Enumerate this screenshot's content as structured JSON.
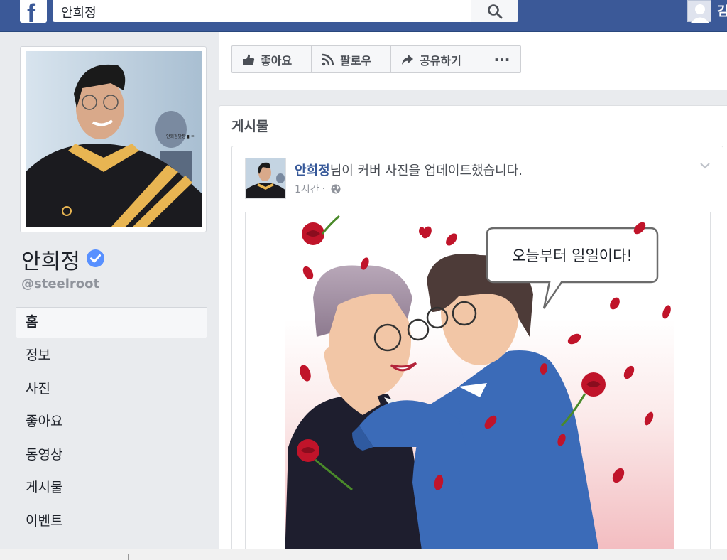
{
  "topbar": {
    "logo": "f",
    "search_value": "안희정",
    "search_icon": "search-icon",
    "user_name_partial": "김"
  },
  "profile": {
    "name": "안희정",
    "handle": "@steelroot",
    "verified_icon": "verified-badge-icon",
    "photo_caption": "안희정맞짱 ▮ ㄷ"
  },
  "nav": {
    "items": [
      {
        "label": "홈",
        "active": true
      },
      {
        "label": "정보"
      },
      {
        "label": "사진"
      },
      {
        "label": "좋아요"
      },
      {
        "label": "동영상"
      },
      {
        "label": "게시물"
      },
      {
        "label": "이벤트"
      }
    ]
  },
  "actions": {
    "like_label": "좋아요",
    "follow_label": "팔로우",
    "share_label": "공유하기",
    "more_label": "···"
  },
  "posts": {
    "section_title": "게시물",
    "post": {
      "author": "안희정",
      "action_text": "님이 커버 사진을 업데이트했습니다.",
      "time": "1시간",
      "separator": "·",
      "privacy_icon": "globe-icon",
      "speech_bubble": "오늘부터 일일이다!"
    }
  },
  "colors": {
    "brand": "#3b5998",
    "link": "#365899",
    "verified": "#5890ff",
    "rose": "#c0142a"
  }
}
